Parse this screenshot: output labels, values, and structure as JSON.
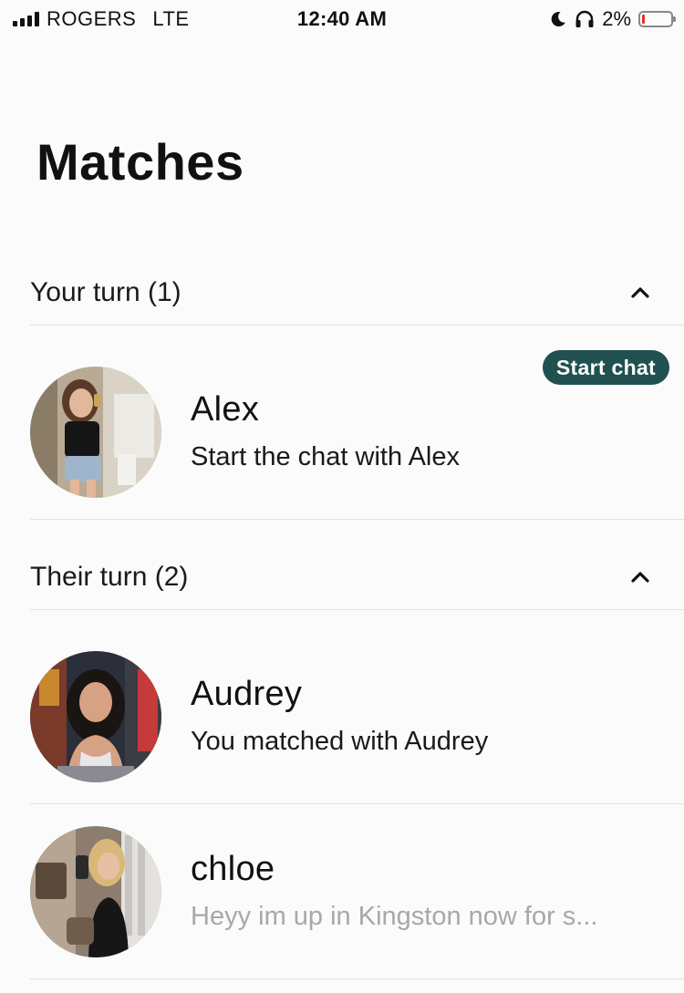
{
  "status_bar": {
    "carrier": "ROGERS",
    "network": "LTE",
    "time": "12:40 AM",
    "battery_percent": "2%",
    "battery_level": 0.02,
    "battery_color": "#e0302a",
    "icons": [
      "signal-icon",
      "moon-icon",
      "headphones-icon",
      "battery-icon"
    ]
  },
  "page": {
    "title": "Matches"
  },
  "sections": [
    {
      "label": "Your turn (1)",
      "collapse_icon": "chevron-up-icon",
      "matches": [
        {
          "name": "Alex",
          "subtitle": "Start the chat with Alex",
          "action_label": "Start chat",
          "action_color": "#205150"
        }
      ]
    },
    {
      "label": "Their turn (2)",
      "collapse_icon": "chevron-up-icon",
      "matches": [
        {
          "name": "Audrey",
          "subtitle": "You matched with Audrey"
        },
        {
          "name": "chloe",
          "subtitle": "Heyy im up in Kingston now for s..."
        }
      ]
    }
  ]
}
